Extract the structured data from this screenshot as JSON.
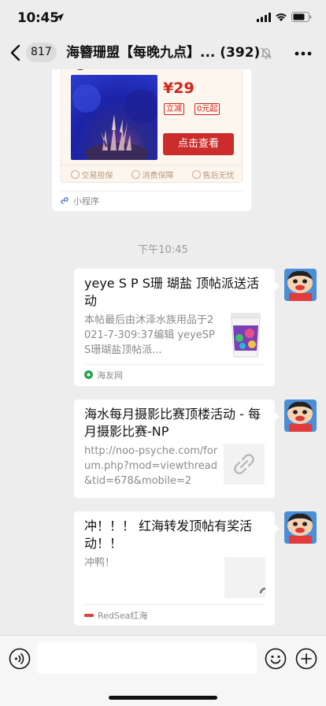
{
  "status_bar": {
    "time": "10:45"
  },
  "nav": {
    "unread_count": "817",
    "title": "海簪珊盟【每晚九点】... (392)"
  },
  "chat": {
    "mini_program": {
      "price": "¥29",
      "tags": [
        "立减",
        "0元起"
      ],
      "view_button": "点击查看",
      "guarantees": [
        "交易担保",
        "消费保障",
        "售后无忧"
      ],
      "footer_label": "小程序"
    },
    "timestamp": "下午10:45",
    "messages": [
      {
        "title": "yeye S P S珊 瑚盐 顶帖派送活动",
        "description": "本帖最后由沐泽水族用品于2021-7-309:37编辑 yeyeSPS珊瑚盐顶帖派...",
        "source": "海友网"
      },
      {
        "title": "海水每月摄影比赛顶楼活动 - 每月摄影比赛-NP",
        "description": "http://noo-psyche.com/forum.php?mod=viewthread&tid=678&mobile=2"
      },
      {
        "title": "冲！！！ 红海转发顶帖有奖活动！！",
        "description": "冲鸭！",
        "source": "RedSea红海"
      }
    ]
  },
  "colors": {
    "background": "#ededed",
    "price_red": "#d4241c",
    "button_red": "#cb2c2c",
    "link_icon_green": "#2aa14f"
  }
}
